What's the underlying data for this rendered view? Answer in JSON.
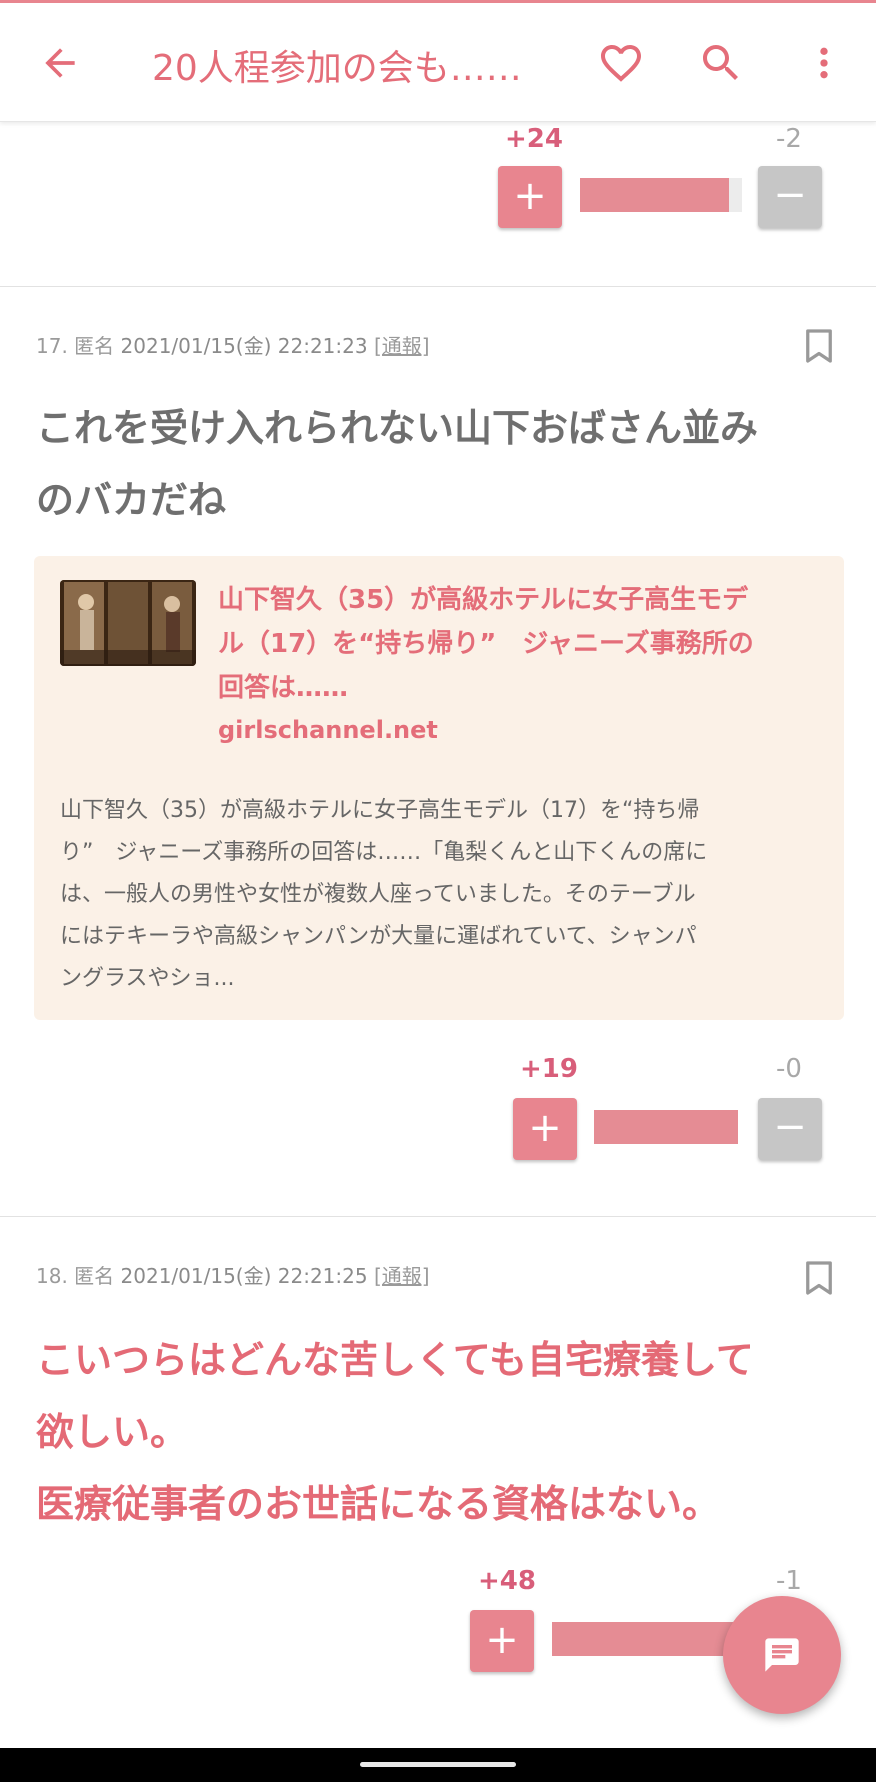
{
  "appbar": {
    "title": "20人程参加の会も……"
  },
  "colors": {
    "accent": "#e46d79",
    "vote_plus": "#e8858f",
    "vote_minus": "#c6c6c6",
    "card_bg": "#fbf1e7"
  },
  "comments": [
    {
      "plus": "+24",
      "minus": "-2",
      "ratio": 0.92
    },
    {
      "number": "17.",
      "author": "匿名",
      "datetime": "2021/01/15(金) 22:21:23",
      "report": "[通報]",
      "body_lines": [
        "これを受け入れられない山下おばさん並み",
        "のバカだね"
      ],
      "link": {
        "title_lines": [
          "山下智久（35）が高級ホテルに女子高生モデ",
          "ル（17）を“持ち帰り”　ジャニーズ事務所の",
          "回答は……"
        ],
        "domain": "girlschannel.net",
        "desc_lines": [
          "山下智久（35）が高級ホテルに女子高生モデル（17）を“持ち帰",
          "り”　ジャニーズ事務所の回答は……「亀梨くんと山下くんの席に",
          "は、一般人の男性や女性が複数人座っていました。そのテーブル",
          "にはテキーラや高級シャンパンが大量に運ばれていて、シャンパ",
          "ングラスやショ..."
        ]
      },
      "plus": "+19",
      "minus": "-0",
      "ratio": 1.0
    },
    {
      "number": "18.",
      "author": "匿名",
      "datetime": "2021/01/15(金) 22:21:25",
      "report": "[通報]",
      "body_lines": [
        "こいつらはどんな苦しくても自宅療養して",
        "欲しい。",
        "医療従事者のお世話になる資格はない。"
      ],
      "plus": "+48",
      "minus": "-1",
      "ratio": 0.98
    }
  ],
  "icons": {
    "back": "arrow-left",
    "favorite": "heart-outline",
    "search": "magnifier",
    "more": "dots-vertical",
    "bookmark": "bookmark-outline",
    "fab": "chat-bubble"
  }
}
